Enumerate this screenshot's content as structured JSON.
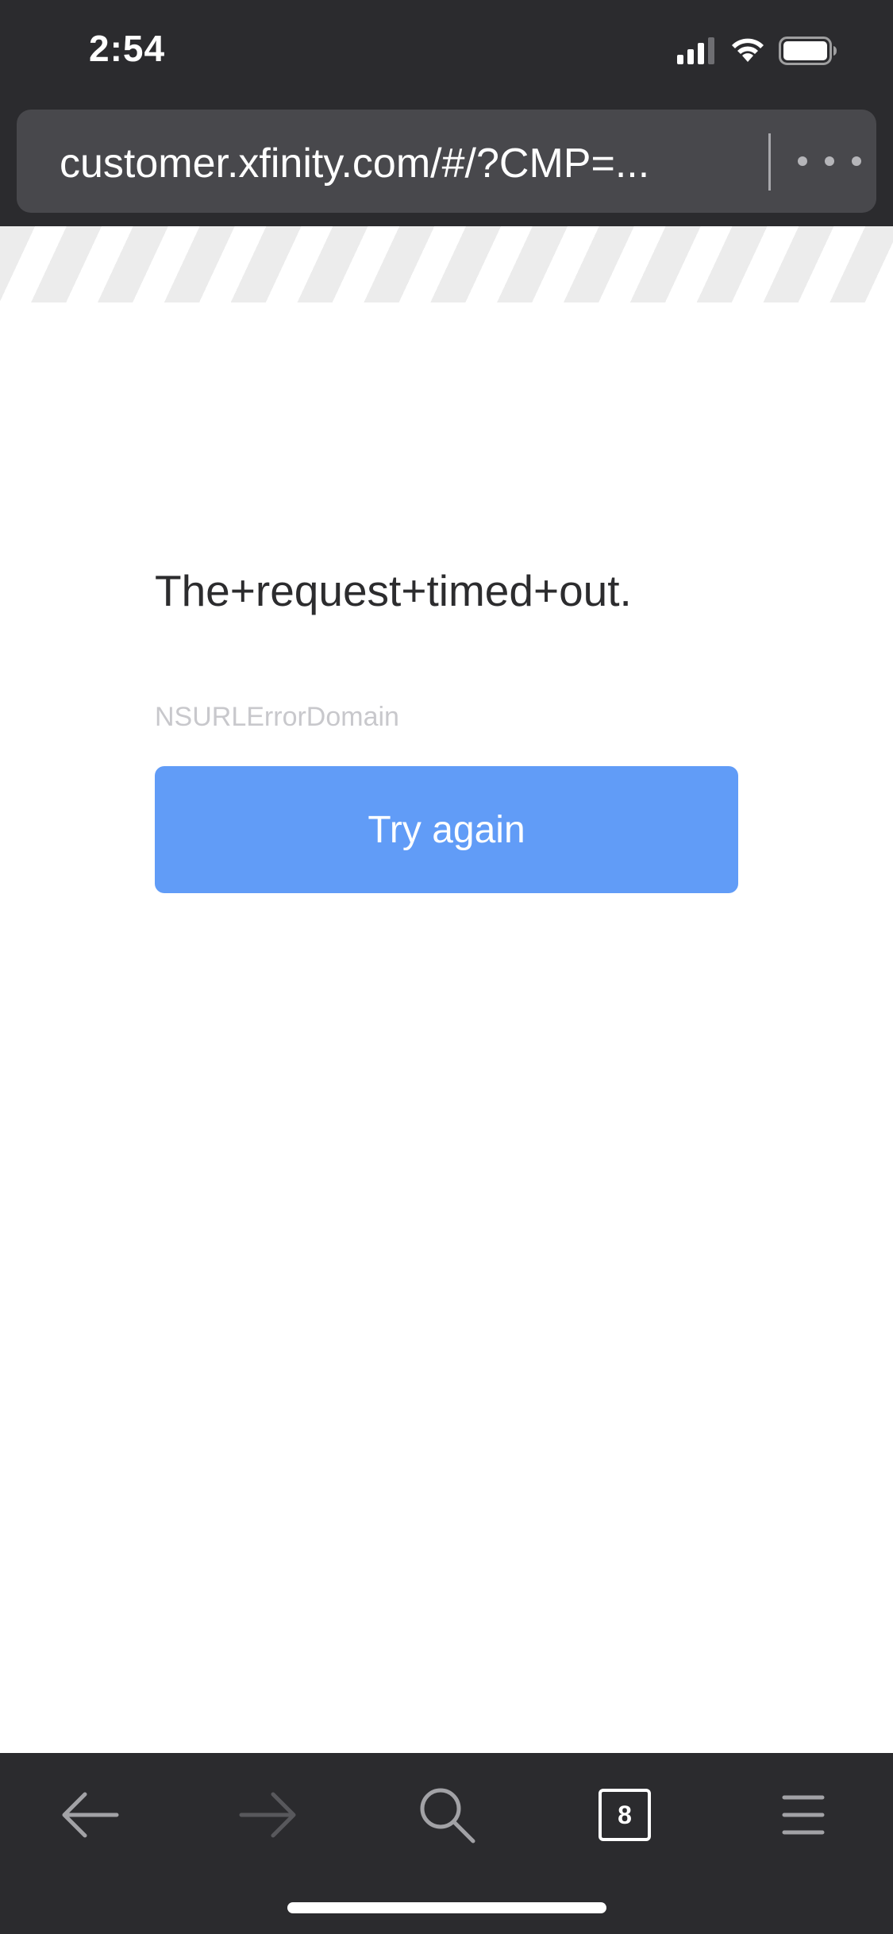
{
  "status_bar": {
    "time": "2:54"
  },
  "url_bar": {
    "url": "customer.xfinity.com/#/?CMP=..."
  },
  "error": {
    "title": "The+request+timed+out.",
    "domain": "NSURLErrorDomain",
    "retry_label": "Try again"
  },
  "toolbar": {
    "tab_count": "8"
  },
  "colors": {
    "chrome_bg": "#2b2b2e",
    "url_field_bg": "#48484c",
    "button_blue": "#619cf7",
    "title_text": "#2c2c2e",
    "domain_text": "#c8c8cc"
  }
}
